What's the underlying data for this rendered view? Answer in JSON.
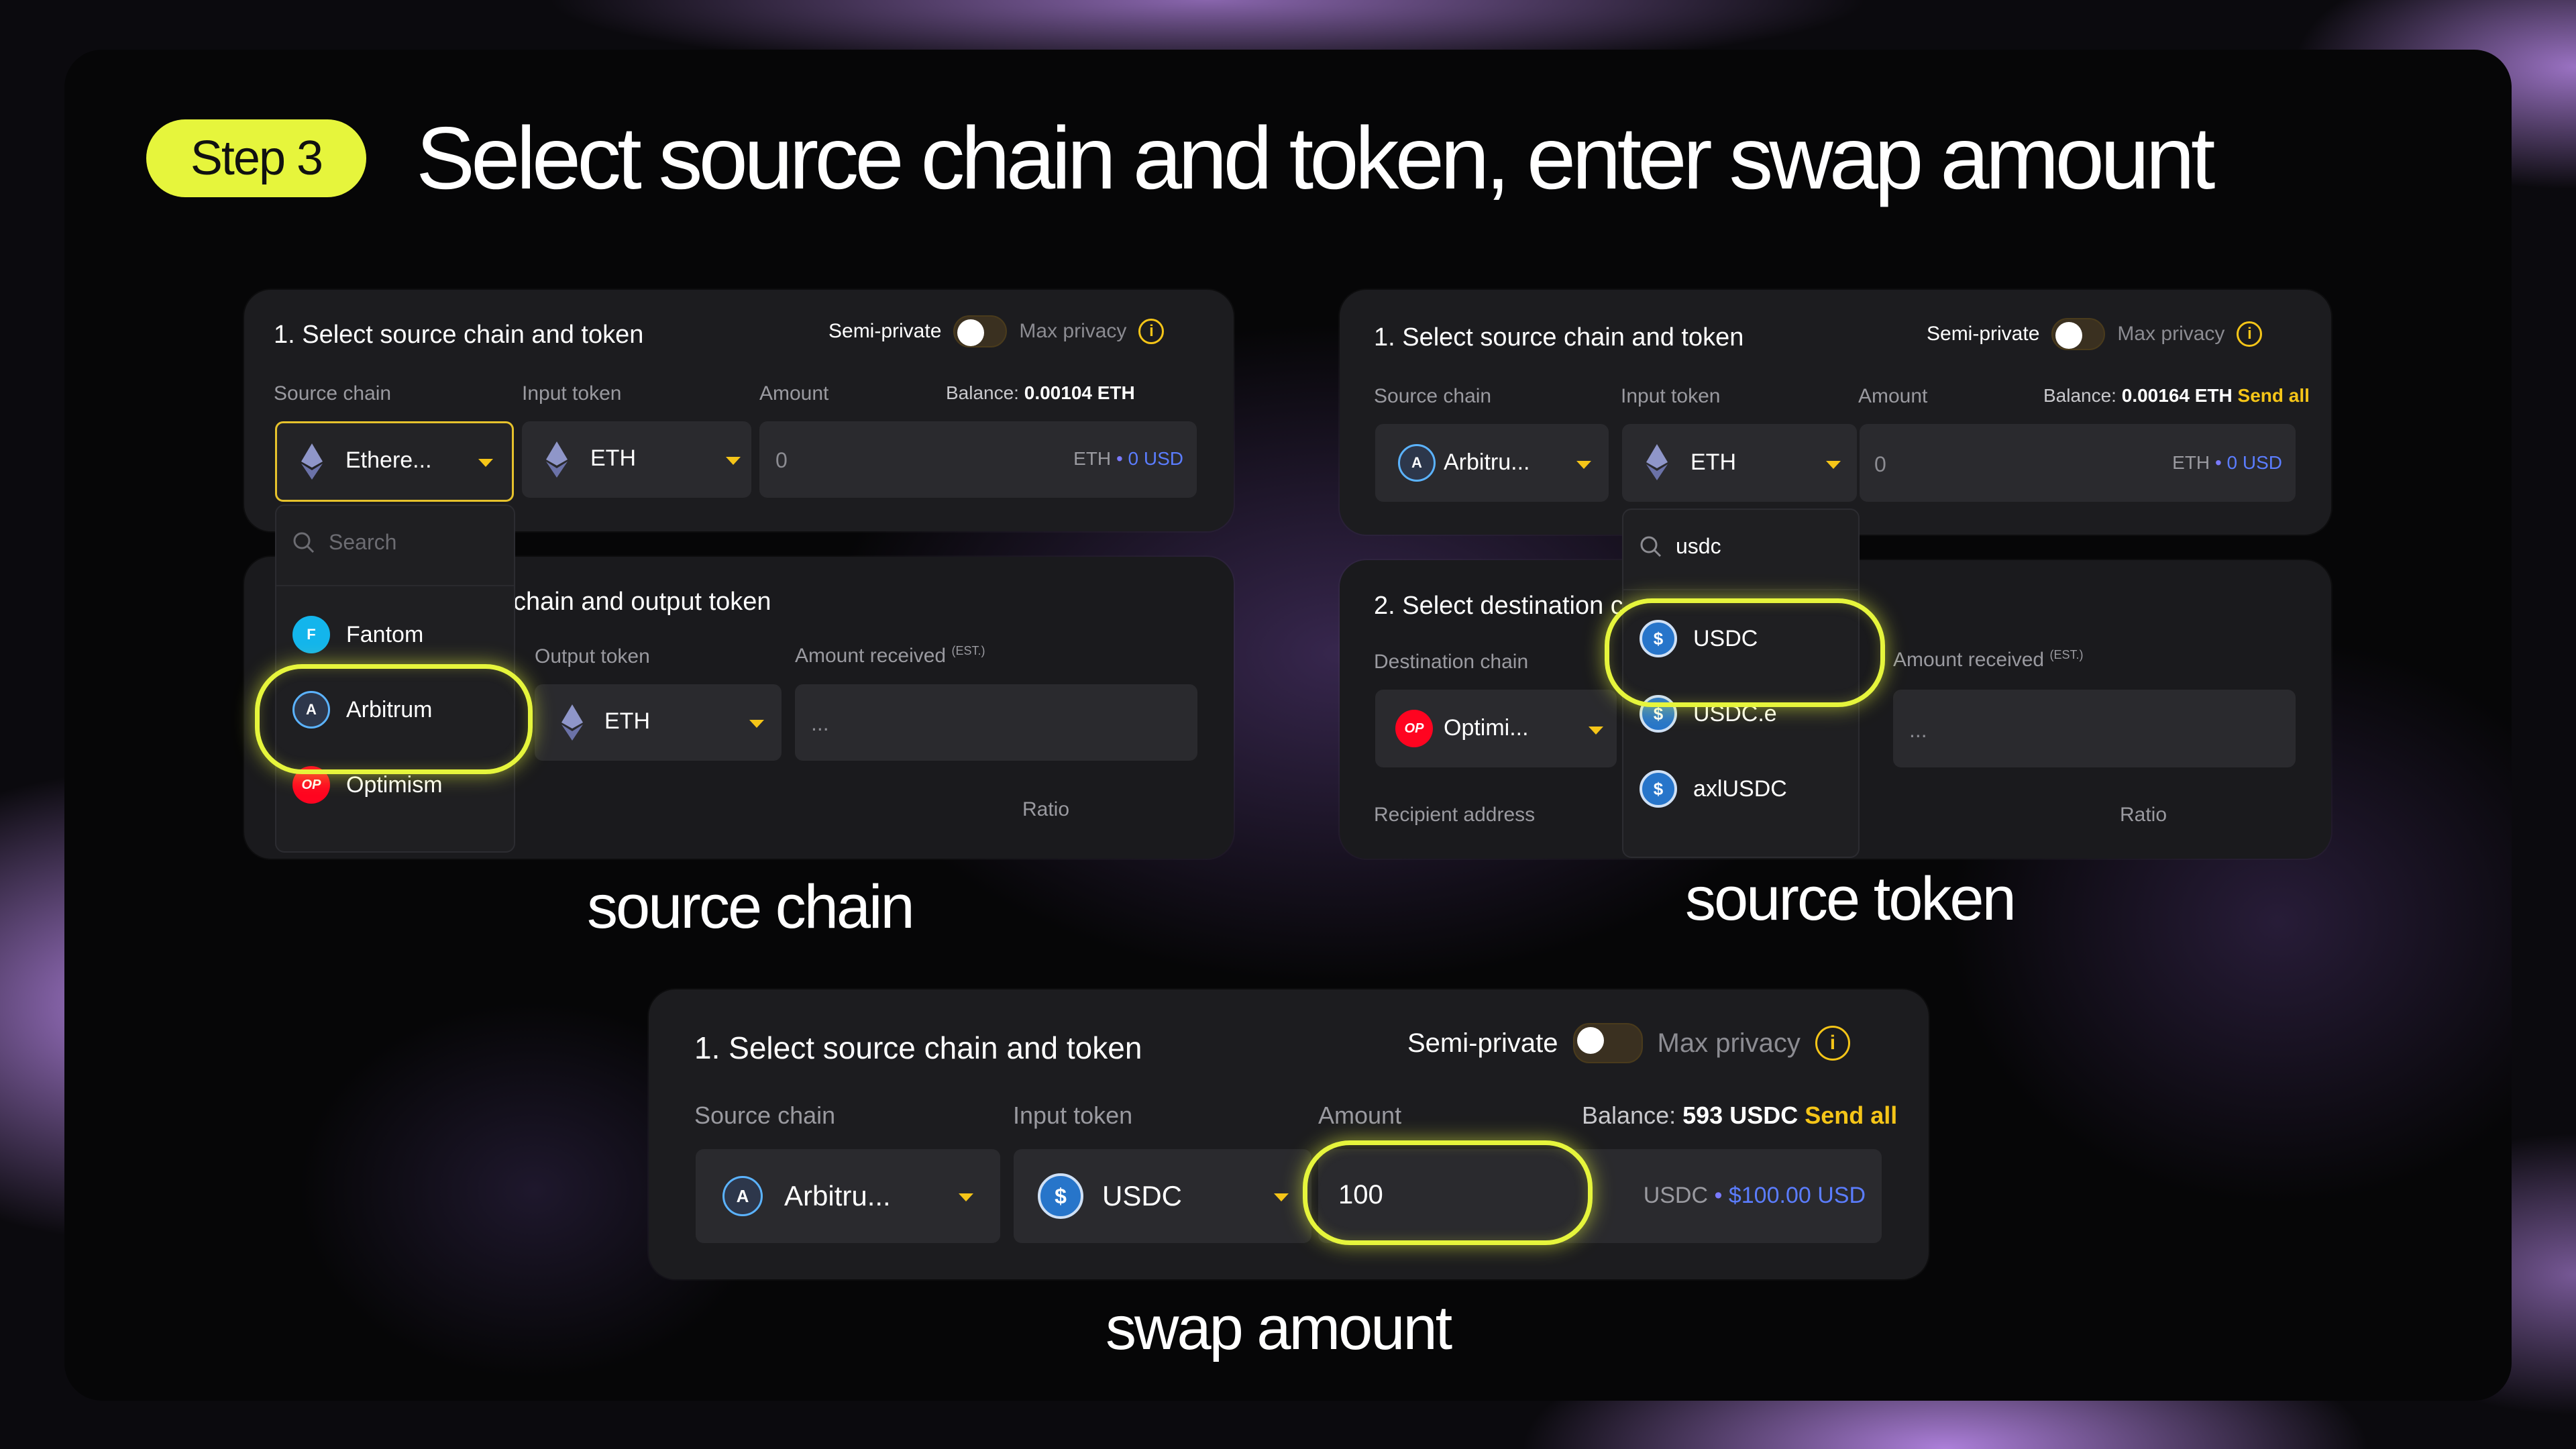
{
  "header": {
    "step": "Step 3",
    "title": "Select source chain and token, enter swap amount"
  },
  "captions": {
    "left": "source chain",
    "right": "source token",
    "bottom": "swap amount"
  },
  "privacy": {
    "semi": "Semi-private",
    "max": "Max privacy",
    "info": "i"
  },
  "labels": {
    "step1": "1. Select source chain and token",
    "source_chain": "Source chain",
    "input_token": "Input token",
    "amount": "Amount",
    "output_token": "Output token",
    "amount_received": "Amount received",
    "est": "(EST.)",
    "destination_chain": "Destination chain",
    "recipient": "Recipient address",
    "ratio": "Ratio",
    "balance": "Balance:",
    "send_all": "Send all",
    "usd_word": "USD"
  },
  "panel1": {
    "chain": "Ethere...",
    "token": "ETH",
    "amount": "0",
    "balance": "0.00104 ETH",
    "usd_token": "ETH",
    "usd_value": "0 USD",
    "step2_fragment": "chain and output token",
    "output_token": "ETH",
    "received": "...",
    "dropdown": {
      "search_placeholder": "Search",
      "items": [
        "Fantom",
        "Arbitrum",
        "Optimism"
      ]
    }
  },
  "panel2": {
    "chain": "Arbitru...",
    "token": "ETH",
    "amount": "0",
    "balance": "0.00164 ETH",
    "usd_token": "ETH",
    "usd_value": "0 USD",
    "step2_title": "2. Select destination c",
    "dest_chain": "Optimi...",
    "received": "...",
    "dropdown": {
      "search_value": "usdc",
      "items": [
        "USDC",
        "USDC.e",
        "axlUSDC"
      ]
    }
  },
  "panel3": {
    "chain": "Arbitru...",
    "token": "USDC",
    "amount": "100",
    "balance": "593 USDC",
    "usd_token": "USDC",
    "usd_value": "$100.00 USD"
  },
  "colors": {
    "accent": "#e6f53c",
    "gold": "#f5c518",
    "link_blue": "#5b7dff"
  }
}
